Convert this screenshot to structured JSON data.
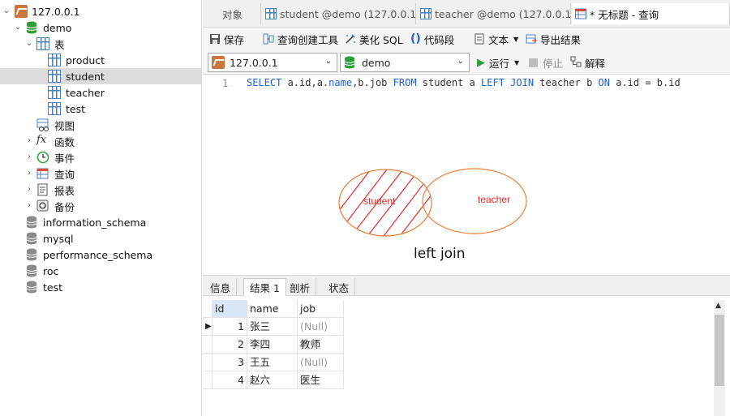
{
  "sidebar": {
    "connection": "127.0.0.1",
    "database": "demo",
    "tables_group": "表",
    "tables": [
      "product",
      "student",
      "teacher",
      "test"
    ],
    "selected_table": "student",
    "groups": [
      "视图",
      "函数",
      "事件",
      "查询",
      "报表",
      "备份"
    ],
    "other_databases": [
      "information_schema",
      "mysql",
      "performance_schema",
      "roc",
      "test"
    ]
  },
  "tabs": {
    "objects": "对象",
    "tab1": "student @demo (127.0.0.1...",
    "tab2": "teacher @demo (127.0.0.1...",
    "tab3": "* 无标题 - 查询"
  },
  "toolbar": {
    "save": "保存",
    "query_builder": "查询创建工具",
    "beautify": "美化 SQL",
    "snippet": "代码段",
    "text": "文本",
    "export": "导出结果"
  },
  "connection_bar": {
    "connection": "127.0.0.1",
    "database": "demo",
    "run": "运行",
    "stop": "停止",
    "explain": "解释"
  },
  "editor": {
    "line_number": "1",
    "sql_parts": [
      "SELECT",
      " a.id,a.",
      "name",
      ",b.job ",
      "FROM",
      " student a ",
      "LEFT JOIN",
      " teacher b ",
      "ON",
      " a.id = b.id"
    ],
    "venn_left": "student",
    "venn_right": "teacher",
    "caption": "left join"
  },
  "result_tabs": [
    "信息",
    "结果 1",
    "剖析",
    "状态"
  ],
  "result": {
    "columns": [
      "id",
      "name",
      "job"
    ],
    "rows": [
      [
        "1",
        "张三",
        "(Null)"
      ],
      [
        "2",
        "李四",
        "教师"
      ],
      [
        "3",
        "王五",
        "(Null)"
      ],
      [
        "4",
        "赵六",
        "医生"
      ]
    ]
  },
  "colors": {
    "accent": "#1f5fd1",
    "selected_row": "#dcdcdc",
    "venn": "#e8803a",
    "venn_text": "#e03030"
  }
}
